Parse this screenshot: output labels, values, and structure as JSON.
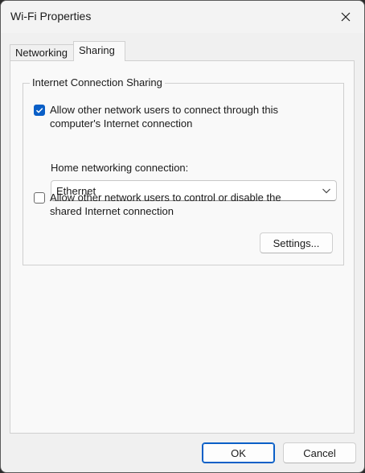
{
  "window": {
    "title": "Wi-Fi Properties"
  },
  "tabs": [
    {
      "label": "Networking",
      "selected": false
    },
    {
      "label": "Sharing",
      "selected": true
    }
  ],
  "sharing": {
    "group_label": "Internet Connection Sharing",
    "allow_connect": {
      "checked": true,
      "line1": "Allow other network users to connect through this",
      "line2": "computer's Internet connection"
    },
    "home_networking_label": "Home networking connection:",
    "home_networking_value": "Ethernet",
    "allow_control": {
      "checked": false,
      "line1": "Allow other network users to control or disable the",
      "line2": "shared Internet connection"
    },
    "settings_label": "Settings..."
  },
  "footer": {
    "ok_label": "OK",
    "cancel_label": "Cancel"
  },
  "colors": {
    "accent": "#0a5fc7",
    "window_bg": "#f0f0f0",
    "panel_bg": "#f9f9f9"
  },
  "icons": {
    "close": "close-icon",
    "dropdown": "chevron-down-icon",
    "check": "checkmark-icon"
  }
}
